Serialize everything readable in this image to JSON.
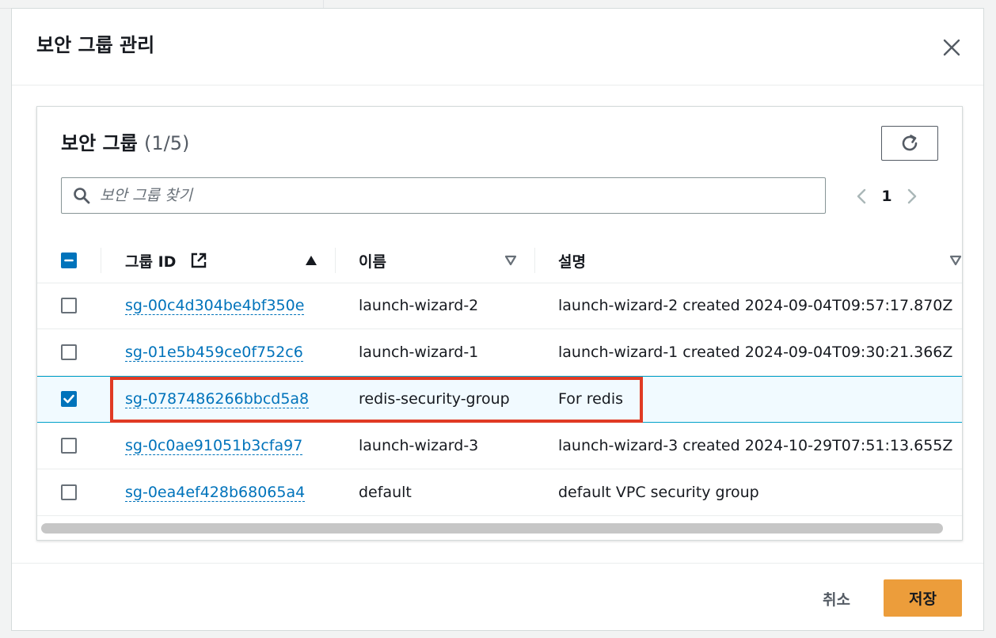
{
  "modal": {
    "title": "보안 그룹 관리",
    "close_icon": "close-icon"
  },
  "container": {
    "title": "보안 그룹",
    "count": "(1/5)"
  },
  "search": {
    "placeholder": "보안 그룹 찾기"
  },
  "pagination": {
    "current_page": "1"
  },
  "table": {
    "columns": [
      {
        "label": "그룹 ID",
        "sort": "ascending"
      },
      {
        "label": "이름",
        "sort": "none"
      },
      {
        "label": "설명",
        "sort": "none"
      }
    ],
    "rows": [
      {
        "group_id": "sg-00c4d304be4bf350e",
        "name": "launch-wizard-2",
        "description": "launch-wizard-2 created 2024-09-04T09:57:17.870Z",
        "checked": false
      },
      {
        "group_id": "sg-01e5b459ce0f752c6",
        "name": "launch-wizard-1",
        "description": "launch-wizard-1 created 2024-09-04T09:30:21.366Z",
        "checked": false
      },
      {
        "group_id": "sg-0787486266bbcd5a8",
        "name": "redis-security-group",
        "description": "For redis",
        "checked": true
      },
      {
        "group_id": "sg-0c0ae91051b3cfa97",
        "name": "launch-wizard-3",
        "description": "launch-wizard-3 created 2024-10-29T07:51:13.655Z",
        "checked": false
      },
      {
        "group_id": "sg-0ea4ef428b68065a4",
        "name": "default",
        "description": "default VPC security group",
        "checked": false
      }
    ]
  },
  "footer": {
    "cancel_label": "취소",
    "save_label": "저장"
  },
  "colors": {
    "link": "#0073bb",
    "primary_button": "#ec9d3b",
    "selected_row": "#f1faff",
    "annotation_box": "#e03a24"
  }
}
